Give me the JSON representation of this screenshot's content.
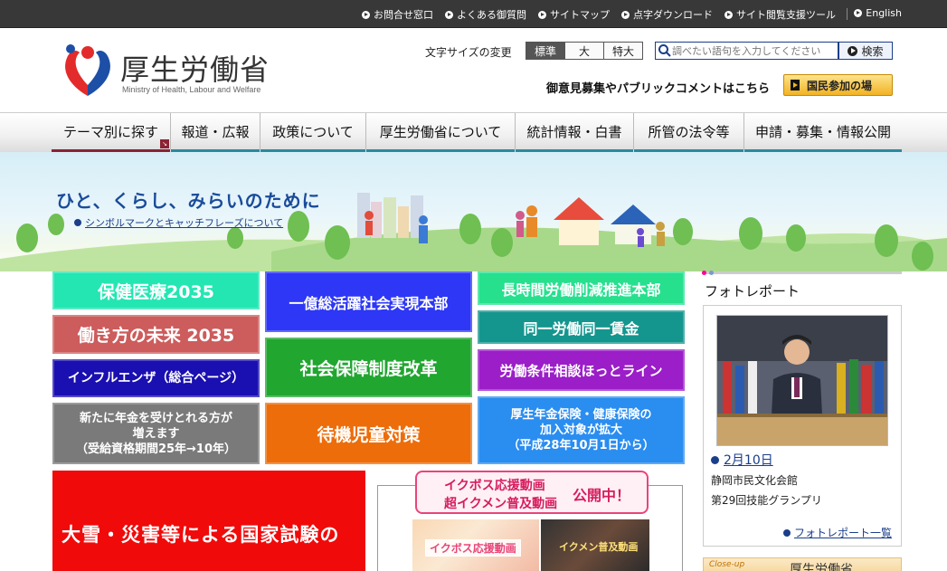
{
  "topbar": {
    "links": [
      "お問合せ窓口",
      "よくある御質問",
      "サイトマップ",
      "点字ダウンロード",
      "サイト閲覧支援ツール"
    ],
    "english": "English"
  },
  "header": {
    "title": "厚生労働省",
    "subtitle": "Ministry of Health, Labour and Welfare",
    "fontsize_label": "文字サイズの変更",
    "fontsize_options": [
      "標準",
      "大",
      "特大"
    ],
    "search_placeholder": "調べたい語句を入力してください",
    "search_button": "検索",
    "opinion_text": "御意見募集やパブリックコメントはこちら",
    "participate_button": "国民参加の場"
  },
  "nav": {
    "items": [
      "テーマ別に探す",
      "報道・広報",
      "政策について",
      "厚生労働省について",
      "統計情報・白書",
      "所管の法令等",
      "申請・募集・情報公開"
    ]
  },
  "hero": {
    "catch": "ひと、くらし、みらいのために",
    "link": "シンボルマークとキャッチフレーズについて"
  },
  "banners": {
    "b1": "保健医療2035",
    "b2": "働き方の未来 2035",
    "b3": "インフルエンザ（総合ページ）",
    "b4_l1": "新たに年金を受けとれる方が",
    "b4_l2": "増えます",
    "b4_l3": "（受給資格期間25年→10年）",
    "b5": "一億総活躍社会実現本部",
    "b6": "社会保障制度改革",
    "b7": "待機児童対策",
    "b8": "長時間労働削減推進本部",
    "b9": "同一労働同一賃金",
    "b10": "労働条件相談ほっとライン",
    "b11_l1": "厚生年金保険・健康保険の",
    "b11_l2": "加入対象が拡大",
    "b11_l3": "（平成28年10月1日から）",
    "red": "大雪・災害等による国家試験の"
  },
  "ikuboss": {
    "line1": "イクボス応援動画",
    "line2": "超イクメン普及動画",
    "status": "公開中！",
    "thumb1_caption": "イクボス応援動画",
    "thumb2_caption": "イクメン普及動画"
  },
  "photo_report": {
    "title": "フォトレポート",
    "date": "2月10日",
    "place": "静岡市民文化会館",
    "event": "第29回技能グランプリ",
    "list_link": "フォトレポート一覧"
  },
  "closeup": {
    "tag": "Close-up",
    "title": "厚生労働省"
  },
  "colors": {
    "accent_blue": "#1a3e8a",
    "nav_underline": "#2a8a9e",
    "nav_active": "#8b2232"
  }
}
